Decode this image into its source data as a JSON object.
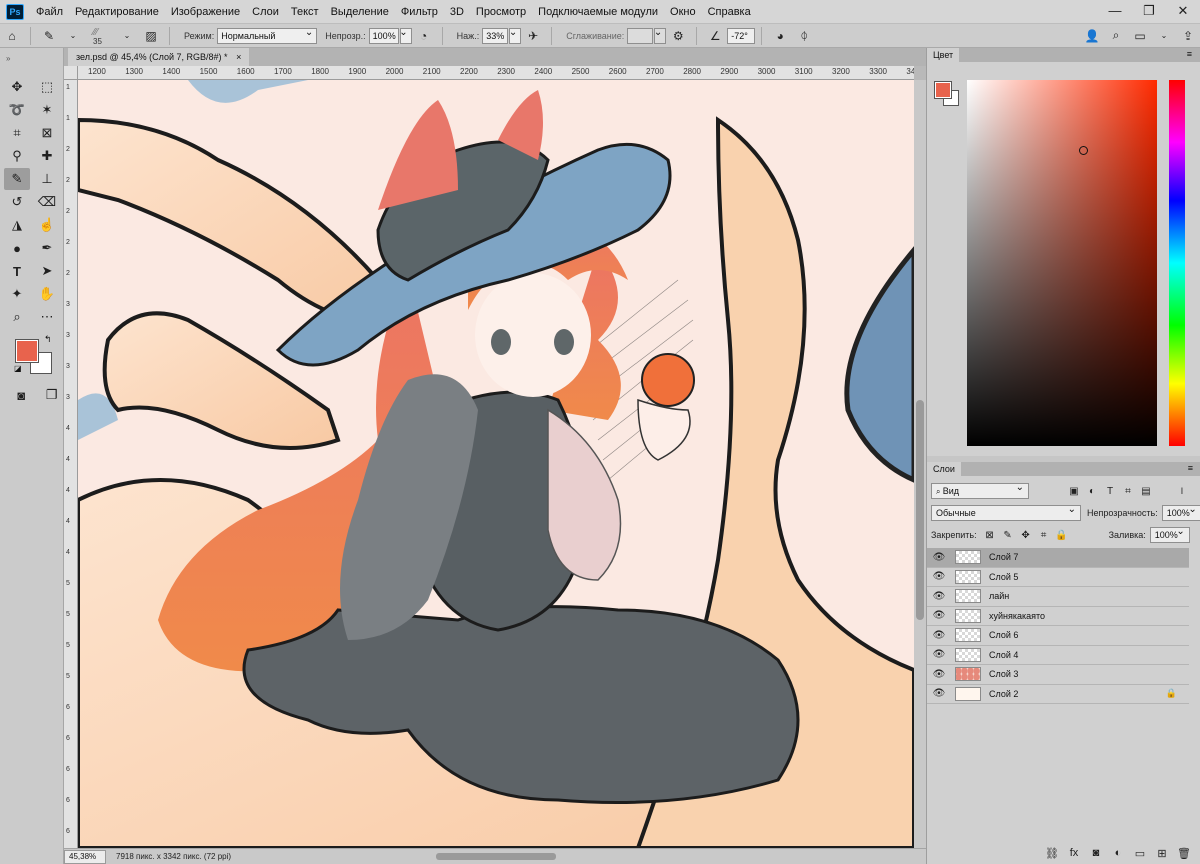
{
  "app": {
    "logo": "Ps",
    "menu": [
      "Файл",
      "Редактирование",
      "Изображение",
      "Слои",
      "Текст",
      "Выделение",
      "Фильтр",
      "3D",
      "Просмотр",
      "Подключаемые модули",
      "Окно",
      "Справка"
    ],
    "window_controls": [
      "—",
      "❐",
      "✕"
    ]
  },
  "options": {
    "brush_size": "35",
    "mode_label": "Режим:",
    "mode_value": "Нормальный",
    "opacity_label": "Непрозр.:",
    "opacity_value": "100%",
    "pressure_label": "Наж.:",
    "pressure_value": "33%",
    "smoothing_label": "Сглаживание:",
    "smoothing_value": "",
    "angle_value": "-72°"
  },
  "document": {
    "tab_title": "зел.psd @ 45,4% (Слой 7, RGB/8#) *",
    "tab_close": "×",
    "ruler_h": [
      "1200",
      "1300",
      "1400",
      "1500",
      "1600",
      "1700",
      "1800",
      "1900",
      "2000",
      "2100",
      "2200",
      "2300",
      "2400",
      "2500",
      "2600",
      "2700",
      "2800",
      "2900",
      "3000",
      "3100",
      "3200",
      "3300",
      "340"
    ],
    "ruler_v": [
      "1",
      "1",
      "2",
      "2",
      "2",
      "2",
      "2",
      "3",
      "3",
      "3",
      "3",
      "4",
      "4",
      "4",
      "4",
      "4",
      "5",
      "5",
      "5",
      "5",
      "6",
      "6",
      "6",
      "6",
      "6"
    ],
    "zoom": "45,38%",
    "info": "7918 пикс. x 3342 пикс. (72 ppi)"
  },
  "colors": {
    "foreground": "#e8634d",
    "background": "#ffffff",
    "picker_hue": "#ff2a00"
  },
  "panels": {
    "color_tab": "Цвет",
    "layers_tab": "Слои",
    "filter_kind": "Вид",
    "blend_mode": "Обычные",
    "opacity_label": "Непрозрачность:",
    "opacity_value": "100%",
    "lock_label": "Закрепить:",
    "fill_label": "Заливка:",
    "fill_value": "100%"
  },
  "layers": [
    {
      "name": "Слой 7",
      "selected": true,
      "thumb": "transparent",
      "locked": false
    },
    {
      "name": "Слой 5",
      "selected": false,
      "thumb": "transparent",
      "locked": false
    },
    {
      "name": "лайн",
      "selected": false,
      "thumb": "transparent",
      "locked": false
    },
    {
      "name": "хуйнякакаято",
      "selected": false,
      "thumb": "transparent",
      "locked": false
    },
    {
      "name": "Слой 6",
      "selected": false,
      "thumb": "transparent",
      "locked": false
    },
    {
      "name": "Слой 4",
      "selected": false,
      "thumb": "transparent",
      "locked": false
    },
    {
      "name": "Слой 3",
      "selected": false,
      "thumb": "art",
      "locked": false
    },
    {
      "name": "Слой 2",
      "selected": false,
      "thumb": "solid",
      "locked": true
    }
  ]
}
